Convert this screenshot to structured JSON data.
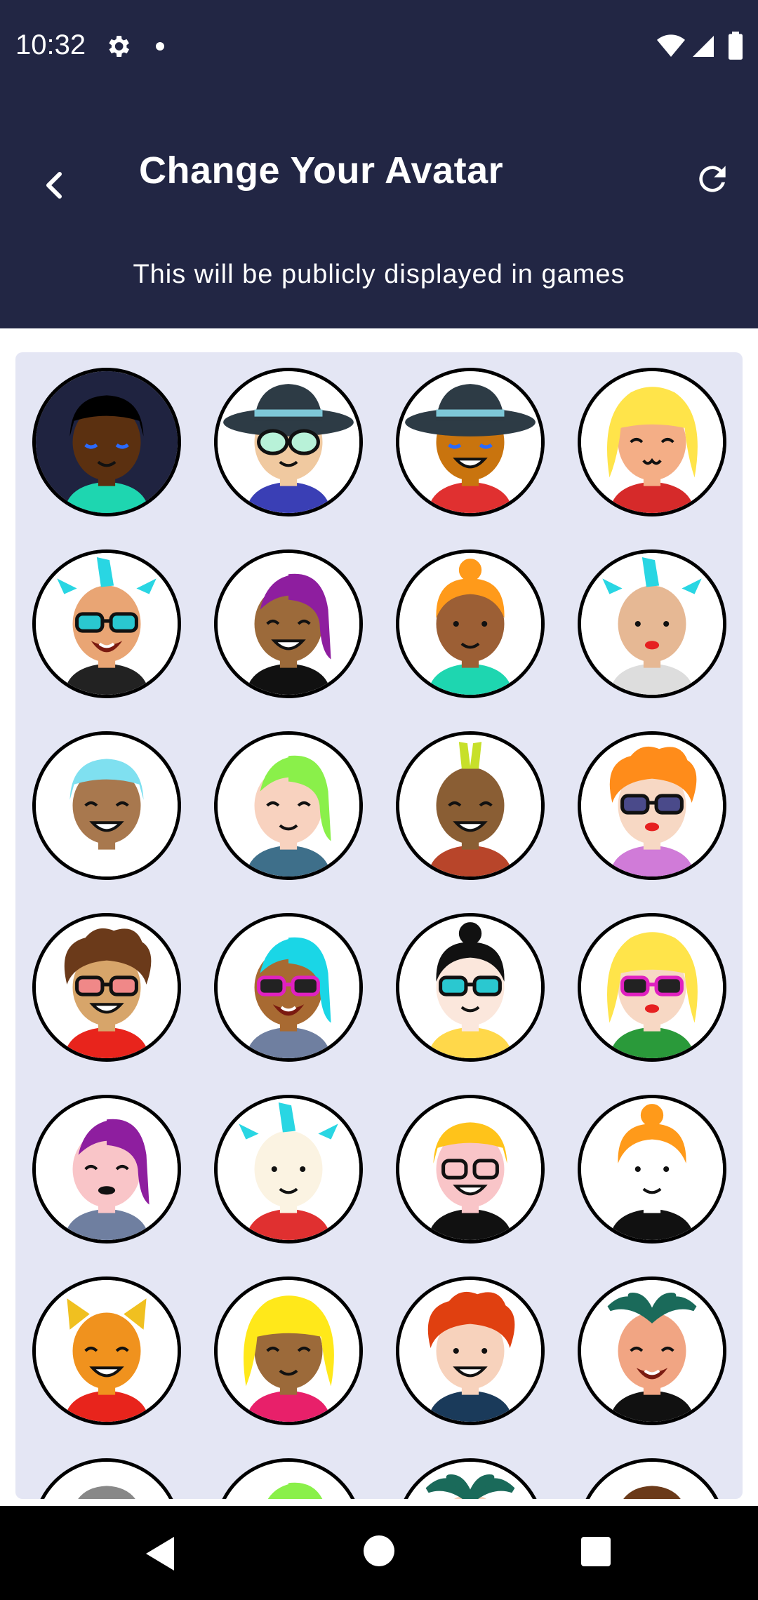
{
  "status_bar": {
    "time": "10:32",
    "icons": [
      "gear-icon",
      "notification-dot-icon",
      "wifi-icon",
      "signal-icon",
      "battery-icon"
    ]
  },
  "header": {
    "title": "Change Your Avatar",
    "subtitle": "This will be publicly displayed in games",
    "back_icon": "chevron-left-icon",
    "refresh_icon": "refresh-icon"
  },
  "colors": {
    "header_bg": "#222644",
    "panel_bg": "#e4e6f4",
    "selected_avatar_bg": "#1f2340"
  },
  "avatars": [
    {
      "skin": "#5b3010",
      "hair": "#000000",
      "hairStyle": "flat",
      "acc": "none",
      "mouth": "smile",
      "eyes": "closed-blue",
      "shirt": "#1ed6b0",
      "selected": true
    },
    {
      "skin": "#f0c9a0",
      "hair": "#2d3b45",
      "hairStyle": "hat",
      "acc": "round-glasses",
      "mouth": "smile",
      "eyes": "none",
      "shirt": "#3a3fb5"
    },
    {
      "skin": "#c9740e",
      "hair": "#2d3b45",
      "hairStyle": "hat",
      "acc": "none",
      "mouth": "grin",
      "eyes": "closed-blue",
      "shirt": "#e03030"
    },
    {
      "skin": "#f4ae86",
      "hair": "#ffe44a",
      "hairStyle": "long",
      "acc": "none",
      "mouth": "cute",
      "eyes": "closed",
      "shirt": "#d62a2a"
    },
    {
      "skin": "#e9a574",
      "hair": "#29d6e3",
      "hairStyle": "spikes",
      "acc": "sunglasses-teal",
      "mouth": "beard",
      "eyes": "none",
      "shirt": "#222222"
    },
    {
      "skin": "#9c6a3a",
      "hair": "#8e1e9f",
      "hairStyle": "side",
      "acc": "none",
      "mouth": "grin",
      "eyes": "closed",
      "shirt": "#111111"
    },
    {
      "skin": "#9c5f35",
      "hair": "#ff9a1a",
      "hairStyle": "bun",
      "acc": "none",
      "mouth": "smile",
      "eyes": "dots",
      "shirt": "#1ed6b0"
    },
    {
      "skin": "#e6b894",
      "hair": "#29d6e3",
      "hairStyle": "spikes",
      "acc": "none",
      "mouth": "lips-red",
      "eyes": "dots",
      "shirt": "#dddddd"
    },
    {
      "skin": "#a8784e",
      "hair": "#7fe0f0",
      "hairStyle": "flat",
      "acc": "none",
      "mouth": "grin",
      "eyes": "closed",
      "shirt": "#ffffff"
    },
    {
      "skin": "#f8d2bf",
      "hair": "#8af04a",
      "hairStyle": "side",
      "acc": "none",
      "mouth": "smile",
      "eyes": "closed",
      "shirt": "#3e6f8a"
    },
    {
      "skin": "#8a5e34",
      "hair": "#c7e02a",
      "hairStyle": "mohawk",
      "acc": "none",
      "mouth": "grin",
      "eyes": "closed",
      "shirt": "#b8452a"
    },
    {
      "skin": "#f7d8c4",
      "hair": "#ff8c1a",
      "hairStyle": "curly",
      "acc": "sunglasses-purple",
      "mouth": "lips-red",
      "eyes": "none",
      "shirt": "#d07bd8"
    },
    {
      "skin": "#d7a56a",
      "hair": "#6b3a1a",
      "hairStyle": "curly",
      "acc": "sunglasses-pink",
      "mouth": "grin",
      "eyes": "none",
      "shirt": "#e8241c"
    },
    {
      "skin": "#a86a32",
      "hair": "#1ad6e6",
      "hairStyle": "side",
      "acc": "sunglasses-magenta",
      "mouth": "beard",
      "eyes": "none",
      "shirt": "#6f7fa0"
    },
    {
      "skin": "#fbe7dc",
      "hair": "#111111",
      "hairStyle": "bun",
      "acc": "sunglasses-teal",
      "mouth": "smile",
      "eyes": "none",
      "shirt": "#ffd84a"
    },
    {
      "skin": "#f7d8c4",
      "hair": "#ffe44a",
      "hairStyle": "long",
      "acc": "sunglasses-magenta",
      "mouth": "lips-red",
      "eyes": "none",
      "shirt": "#2a9a3a"
    },
    {
      "skin": "#f9c5c8",
      "hair": "#8e1e9f",
      "hairStyle": "side",
      "acc": "none",
      "mouth": "lips-dark",
      "eyes": "closed",
      "shirt": "#6f7fa0"
    },
    {
      "skin": "#fbf3e2",
      "hair": "#29d6e3",
      "hairStyle": "spikes",
      "acc": "none",
      "mouth": "smile",
      "eyes": "dots",
      "shirt": "#e03030"
    },
    {
      "skin": "#f9c5c8",
      "hair": "#ffc31a",
      "hairStyle": "flat",
      "acc": "round-glasses-dark",
      "mouth": "grin",
      "eyes": "none",
      "shirt": "#111111"
    },
    {
      "skin": "#ffffff",
      "hair": "#ff9a1a",
      "hairStyle": "bun",
      "acc": "none",
      "mouth": "smile",
      "eyes": "dots",
      "shirt": "#111111"
    },
    {
      "skin": "#f0921e",
      "hair": "#f0c020",
      "hairStyle": "ears",
      "acc": "none",
      "mouth": "grin",
      "eyes": "closed",
      "shirt": "#e8241c"
    },
    {
      "skin": "#9c6a3a",
      "hair": "#ffe81a",
      "hairStyle": "long",
      "acc": "none",
      "mouth": "smile",
      "eyes": "closed",
      "shirt": "#e8206a"
    },
    {
      "skin": "#f7d2bc",
      "hair": "#e04010",
      "hairStyle": "curly",
      "acc": "none",
      "mouth": "grin",
      "eyes": "dots",
      "shirt": "#1a3a5a"
    },
    {
      "skin": "#f1a583",
      "hair": "#1a6a5a",
      "hairStyle": "palm",
      "acc": "none",
      "mouth": "beard",
      "eyes": "closed",
      "shirt": "#111111"
    },
    {
      "skin": "#e9cfb0",
      "hair": "#888888",
      "hairStyle": "flat",
      "acc": "none",
      "mouth": "smile",
      "eyes": "none",
      "shirt": "#ffffff"
    },
    {
      "skin": "#f7d2bc",
      "hair": "#8af04a",
      "hairStyle": "side",
      "acc": "none",
      "mouth": "smile",
      "eyes": "none",
      "shirt": "#ffffff"
    },
    {
      "skin": "#f7d2bc",
      "hair": "#1a6a5a",
      "hairStyle": "palm",
      "acc": "none",
      "mouth": "smile",
      "eyes": "none",
      "shirt": "#ffffff"
    },
    {
      "skin": "#8a5a2a",
      "hair": "#6b3a1a",
      "hairStyle": "flat",
      "acc": "none",
      "mouth": "smile",
      "eyes": "none",
      "shirt": "#ffffff"
    }
  ],
  "nav_bar": {
    "icons": [
      "back-triangle-icon",
      "home-circle-icon",
      "recents-square-icon"
    ]
  }
}
